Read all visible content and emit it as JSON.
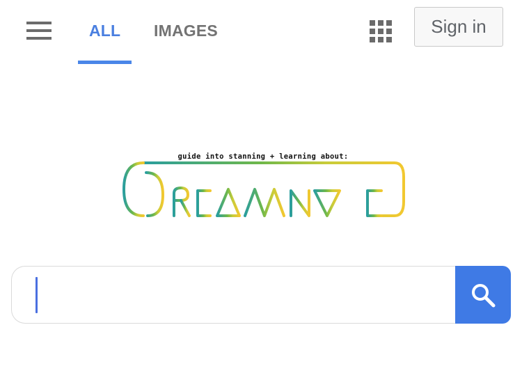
{
  "header": {
    "tabs": [
      {
        "label": "ALL",
        "active": true
      },
      {
        "label": "IMAGES",
        "active": false
      }
    ],
    "menu_icon": "hamburger-menu-icon",
    "apps_icon": "apps-grid-icon",
    "sign_in_label": "Sign in"
  },
  "logo": {
    "tagline": "guide into stanning + learning about:",
    "wordmark": "DREAMNOTE",
    "gradient_colors": [
      "#2a9e9e",
      "#6fb84a",
      "#c8cc3a",
      "#f2c830"
    ]
  },
  "search": {
    "value": "",
    "placeholder": "",
    "button_icon": "search-icon"
  },
  "colors": {
    "accent": "#4a86e8",
    "search_button": "#3f7ae5",
    "inactive_tab": "#737373"
  }
}
